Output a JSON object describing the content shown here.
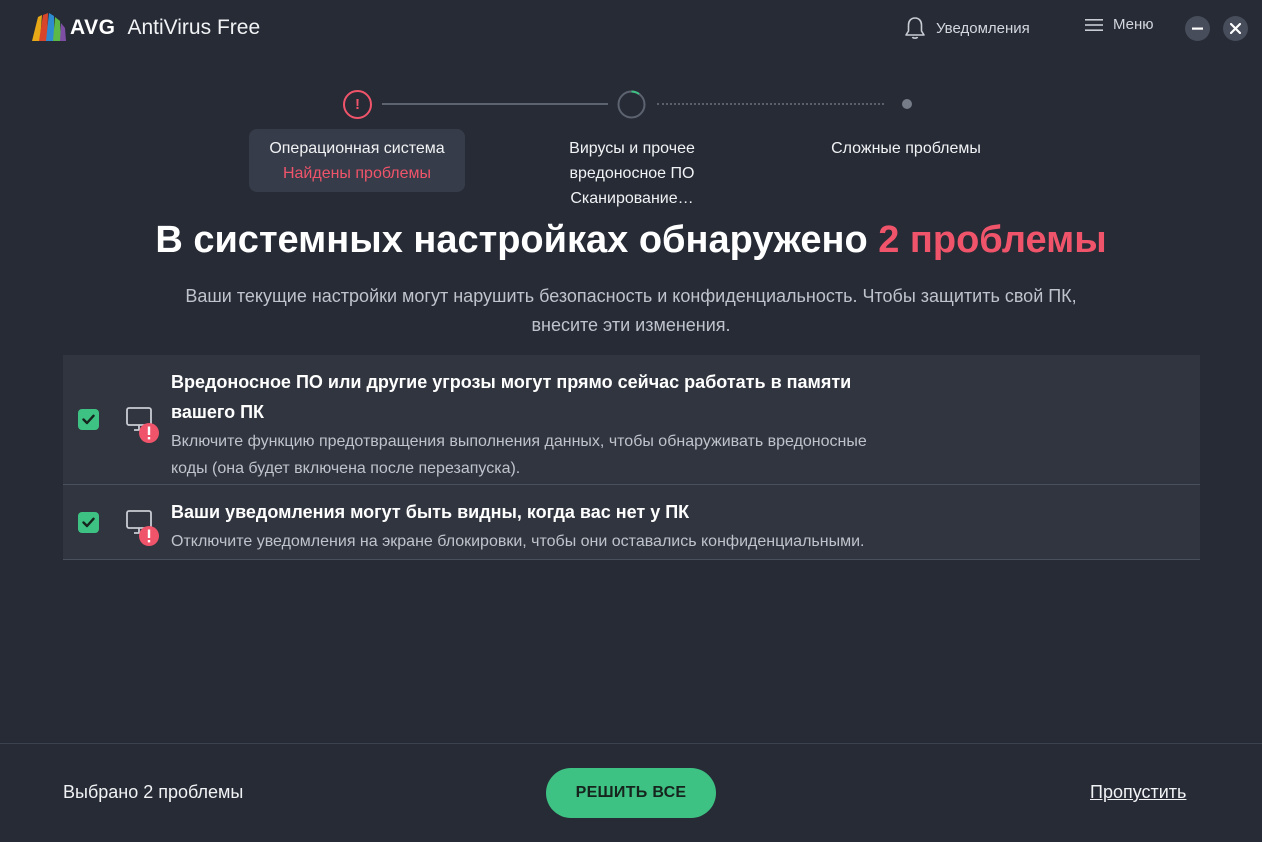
{
  "app": {
    "brand": "AVG",
    "product": "AntiVirus Free"
  },
  "header": {
    "notifications_label": "Уведомления",
    "menu_label": "Меню"
  },
  "stepper": {
    "steps": [
      {
        "title": "Операционная система",
        "status": "Найдены проблемы",
        "state": "warning"
      },
      {
        "title_line1": "Вирусы и прочее",
        "title_line2": "вредоносное ПО",
        "status": "Сканирование…",
        "state": "in-progress"
      },
      {
        "title": "Сложные проблемы",
        "state": "pending"
      }
    ]
  },
  "main": {
    "headline_prefix": "В системных настройках обнаружено",
    "headline_accent": "2 проблемы",
    "subtitle_line1": "Ваши текущие настройки могут нарушить безопасность и конфиденциальность. Чтобы защитить свой ПК,",
    "subtitle_line2": "внесите эти изменения."
  },
  "issues": [
    {
      "title_line1": "Вредоносное ПО или другие угрозы могут прямо сейчас работать в памяти",
      "title_line2": "вашего ПК",
      "desc_line1": "Включите функцию предотвращения выполнения данных, чтобы обнаруживать вредоносные",
      "desc_line2": "коды (она будет включена после перезапуска).",
      "checked": true
    },
    {
      "title": "Ваши уведомления могут быть видны, когда вас нет у ПК",
      "desc": "Отключите уведомления на экране блокировки, чтобы они оставались конфиденциальными.",
      "checked": true
    }
  ],
  "footer": {
    "selected_count": "Выбрано 2 проблемы",
    "solve_all_label": "РЕШИТЬ ВСЕ",
    "skip_label": "Пропустить"
  },
  "colors": {
    "background": "#262b36",
    "panel": "#30353f",
    "accent_red": "#f0546a",
    "accent_green": "#3ec283"
  }
}
